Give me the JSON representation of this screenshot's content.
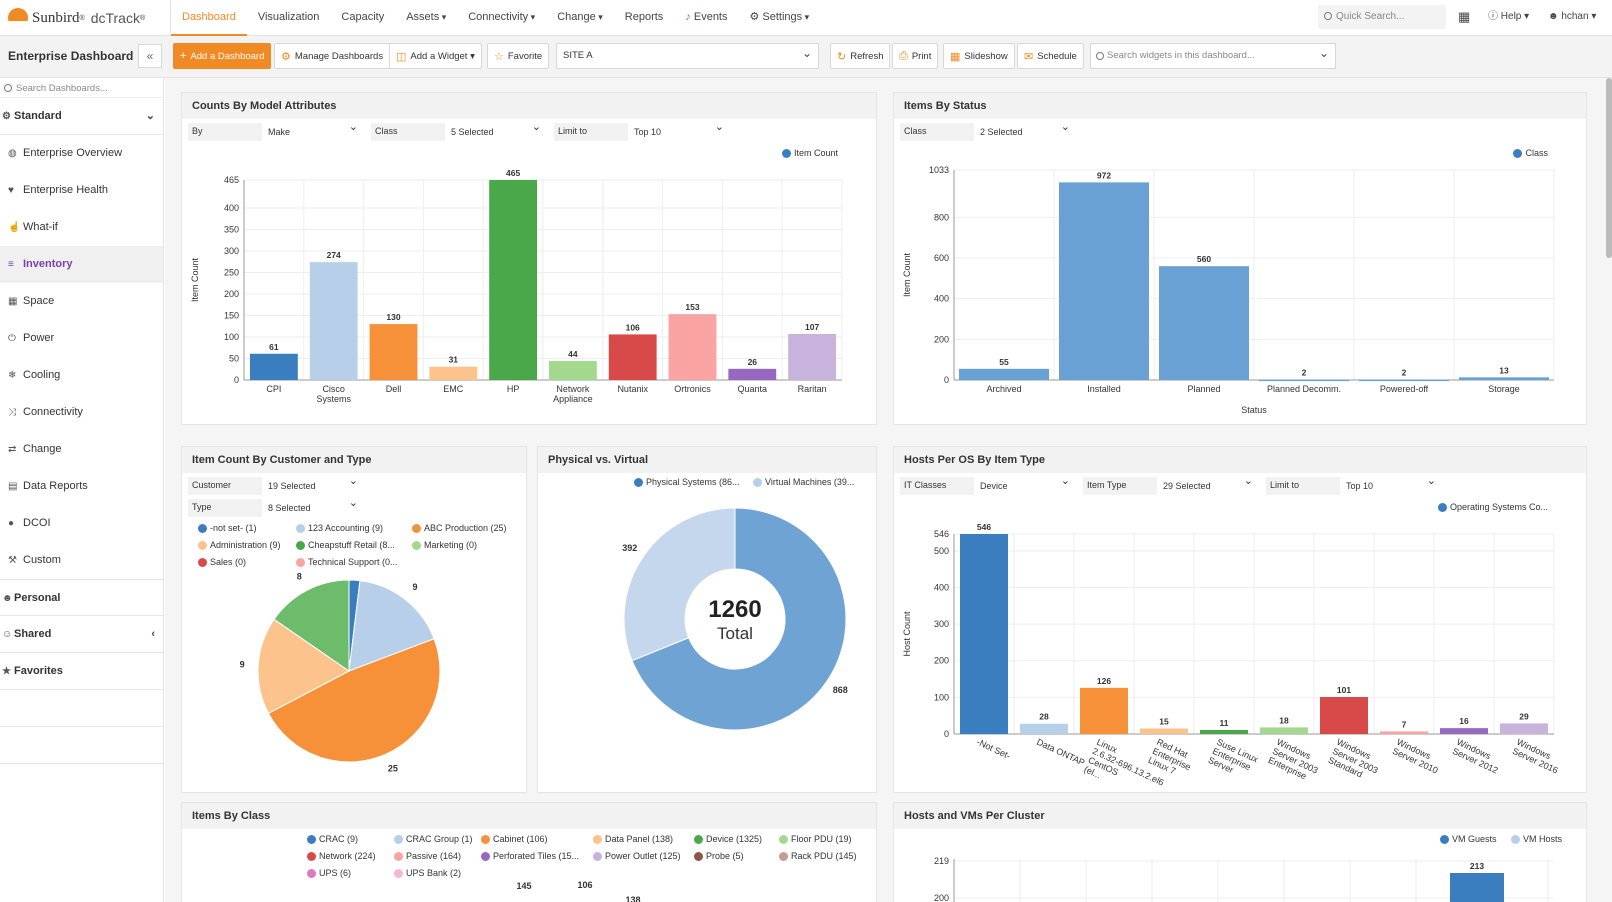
{
  "app": {
    "brand": "Sunbird",
    "product": "dcTrack"
  },
  "nav": [
    {
      "label": "Dashboard",
      "active": true,
      "caret": false
    },
    {
      "label": "Visualization",
      "caret": false
    },
    {
      "label": "Capacity",
      "caret": false
    },
    {
      "label": "Assets",
      "caret": true
    },
    {
      "label": "Connectivity",
      "caret": true
    },
    {
      "label": "Change",
      "caret": true
    },
    {
      "label": "Reports",
      "caret": false
    },
    {
      "label": "Events",
      "caret": false
    },
    {
      "label": "Settings",
      "caret": true
    }
  ],
  "quick_search": {
    "placeholder": "Quick Search..."
  },
  "help_label": "Help",
  "user_label": "hchan",
  "dashboard_title": "Enterprise Dashboard",
  "toolbar": {
    "add_dashboard": "Add a Dashboard",
    "manage_dashboards": "Manage Dashboards",
    "add_widget": "Add a Widget",
    "favorite": "Favorite",
    "site": "SITE A",
    "refresh": "Refresh",
    "print": "Print",
    "slideshow": "Slideshow",
    "schedule": "Schedule",
    "search_widgets_placeholder": "Search widgets in this dashboard..."
  },
  "sidebar": {
    "search_placeholder": "Search Dashboards...",
    "standard": "Standard",
    "items": [
      {
        "label": "Enterprise Overview",
        "icon": "globe-icon",
        "glyph": "◍"
      },
      {
        "label": "Enterprise Health",
        "icon": "heart-icon",
        "glyph": "♥"
      },
      {
        "label": "What-if",
        "icon": "thumbs-up-icon",
        "glyph": "☝"
      },
      {
        "label": "Inventory",
        "icon": "barcode-icon",
        "glyph": "≡",
        "active": true
      },
      {
        "label": "Space",
        "icon": "cubes-icon",
        "glyph": "▦"
      },
      {
        "label": "Power",
        "icon": "power-icon",
        "glyph": "⏻"
      },
      {
        "label": "Cooling",
        "icon": "thermometer-icon",
        "glyph": "❄"
      },
      {
        "label": "Connectivity",
        "icon": "random-icon",
        "glyph": "⤨"
      },
      {
        "label": "Change",
        "icon": "exchange-icon",
        "glyph": "⇄"
      },
      {
        "label": "Data Reports",
        "icon": "table-icon",
        "glyph": "▤"
      },
      {
        "label": "DCOI",
        "icon": "circle-icon",
        "glyph": "●"
      },
      {
        "label": "Custom",
        "icon": "wrench-icon",
        "glyph": "⚒"
      }
    ],
    "personal": "Personal",
    "shared": "Shared",
    "favorites": "Favorites"
  },
  "panels": {
    "counts_model": {
      "title": "Counts By Model Attributes",
      "filters": [
        {
          "label": "By",
          "value": "Make"
        },
        {
          "label": "Class",
          "value": "5 Selected"
        },
        {
          "label": "Limit to",
          "value": "Top 10"
        }
      ]
    },
    "items_status": {
      "title": "Items By Status",
      "filters": [
        {
          "label": "Class",
          "value": "2 Selected"
        }
      ]
    },
    "customer_type": {
      "title": "Item Count By Customer and Type",
      "filters": [
        {
          "label": "Customer",
          "value": "19 Selected"
        },
        {
          "label": "Type",
          "value": "8 Selected"
        }
      ]
    },
    "phys_virtual": {
      "title": "Physical vs. Virtual"
    },
    "hosts_os": {
      "title": "Hosts Per OS By Item Type",
      "filters": [
        {
          "label": "IT Classes",
          "value": "Device"
        },
        {
          "label": "Item Type",
          "value": "29 Selected"
        },
        {
          "label": "Limit to",
          "value": "Top 10"
        }
      ]
    },
    "items_class": {
      "title": "Items By Class"
    },
    "hosts_vms": {
      "title": "Hosts and VMs Per Cluster"
    }
  },
  "chart_data": [
    {
      "type": "bar",
      "title": "Counts By Model Attributes",
      "categories": [
        "CPI",
        "Cisco Systems",
        "Dell",
        "EMC",
        "HP",
        "Network Appliance",
        "Nutanix",
        "Ortronics",
        "Quanta",
        "Raritan"
      ],
      "values": [
        61,
        274,
        130,
        31,
        465,
        44,
        106,
        153,
        26,
        107
      ],
      "colors": [
        "#3a7ebf",
        "#b7cfe9",
        "#f6913a",
        "#fdc38d",
        "#4aa84a",
        "#a3d98e",
        "#d84a4a",
        "#f9a3a2",
        "#9668c2",
        "#c8b3dc"
      ],
      "ylabel": "Item Count",
      "legend": [
        "Item Count"
      ],
      "yticks": [
        0,
        50,
        100,
        150,
        200,
        250,
        300,
        350,
        400,
        465
      ],
      "ylim": [
        0,
        465
      ]
    },
    {
      "type": "bar",
      "title": "Items By Status",
      "categories": [
        "Archived",
        "Installed",
        "Planned",
        "Planned Decomm.",
        "Powered-off",
        "Storage"
      ],
      "values": [
        55,
        972,
        560,
        2,
        2,
        13
      ],
      "xlabel": "Status",
      "ylabel": "Item Count",
      "legend": [
        "Class"
      ],
      "yticks": [
        0,
        200,
        400,
        600,
        800,
        1033
      ],
      "ylim": [
        0,
        1033
      ]
    },
    {
      "type": "pie",
      "title": "Item Count By Customer and Type",
      "legend": [
        {
          "label": "-not set- (1)",
          "color": "#3a7ebf"
        },
        {
          "label": "123 Accounting (9)",
          "color": "#b7cfe9"
        },
        {
          "label": "ABC Production (25)",
          "color": "#f6913a"
        },
        {
          "label": "Administration (9)",
          "color": "#fdc38d"
        },
        {
          "label": "Cheapstuff Retail (8...",
          "color": "#4aa84a"
        },
        {
          "label": "Marketing (0)",
          "color": "#a3d98e"
        },
        {
          "label": "Sales (0)",
          "color": "#d84a4a"
        },
        {
          "label": "Technical Support (0...",
          "color": "#f9a3a2"
        }
      ],
      "slices": [
        {
          "value": 1,
          "color": "#3a7ebf",
          "label": ""
        },
        {
          "value": 9,
          "color": "#b7cfe9",
          "label": "9"
        },
        {
          "value": 25,
          "color": "#f6913a",
          "label": "25"
        },
        {
          "value": 9,
          "color": "#fdc38d",
          "label": "9"
        },
        {
          "value": 8,
          "color": "#6cbc6c",
          "label": "8"
        }
      ]
    },
    {
      "type": "pie",
      "title": "Physical vs. Virtual",
      "legend": [
        {
          "label": "Physical Systems (86...",
          "color": "#3a7ebf"
        },
        {
          "label": "Virtual Machines (39...",
          "color": "#b7cfe9"
        }
      ],
      "slices": [
        {
          "value": 868,
          "color": "#6fa3d3",
          "label": "868"
        },
        {
          "value": 392,
          "color": "#c4d7ed",
          "label": "392"
        }
      ],
      "total": "1260",
      "total_label": "Total"
    },
    {
      "type": "bar",
      "title": "Hosts Per OS By Item Type",
      "categories": [
        "-Not Set-",
        "Data ONTAP",
        "Linux 2.6.32-696.13.2.el6 CentOS",
        "Red Hat Enterprise Linux 7",
        "Suse Linux Enterprise Server",
        "Windows Server 2003 Enterprise",
        "Windows Server 2003 Standard",
        "Windows Server 2010",
        "Windows Server 2012",
        "Windows Server 2016"
      ],
      "category_lines": [
        [
          "-Not Set-"
        ],
        [
          "Data ONTAP"
        ],
        [
          "Linux",
          "2.6.32-696.13.2.el6",
          "CentOS",
          "(el..."
        ],
        [
          "Red Hat",
          "Enterprise",
          "Linux 7"
        ],
        [
          "Suse Linux",
          "Enterprise",
          "Server"
        ],
        [
          "Windows",
          "Server 2003",
          "Enterprise"
        ],
        [
          "Windows",
          "Server 2003",
          "Standard"
        ],
        [
          "Windows",
          "Server 2010"
        ],
        [
          "Windows",
          "Server 2012"
        ],
        [
          "Windows",
          "Server 2016"
        ]
      ],
      "values": [
        546,
        28,
        126,
        15,
        11,
        18,
        101,
        7,
        16,
        29
      ],
      "colors": [
        "#3a7ebf",
        "#b7cfe9",
        "#f6913a",
        "#fdc38d",
        "#4aa84a",
        "#a3d98e",
        "#d84a4a",
        "#f9a3a2",
        "#9668c2",
        "#c8b3dc"
      ],
      "ylabel": "Host Count",
      "legend": [
        "Operating Systems Co..."
      ],
      "yticks": [
        0,
        100,
        200,
        300,
        400,
        500,
        546
      ],
      "ylim": [
        0,
        546
      ]
    },
    {
      "type": "pie",
      "title": "Items By Class",
      "legend": [
        {
          "label": "CRAC (9)",
          "color": "#3a7ebf"
        },
        {
          "label": "CRAC Group (1)",
          "color": "#b7cfe9"
        },
        {
          "label": "Cabinet (106)",
          "color": "#f6913a"
        },
        {
          "label": "Data Panel (138)",
          "color": "#fdc38d"
        },
        {
          "label": "Device (1325)",
          "color": "#4aa84a"
        },
        {
          "label": "Floor PDU (19)",
          "color": "#a3d98e"
        },
        {
          "label": "Network (224)",
          "color": "#d84a4a"
        },
        {
          "label": "Passive (164)",
          "color": "#f9a3a2"
        },
        {
          "label": "Perforated Tiles (15...",
          "color": "#9668c2"
        },
        {
          "label": "Power Outlet (125)",
          "color": "#c8b3dc"
        },
        {
          "label": "Probe (5)",
          "color": "#8c564b"
        },
        {
          "label": "Rack PDU (145)",
          "color": "#c49c94"
        },
        {
          "label": "UPS (6)",
          "color": "#e377c2"
        },
        {
          "label": "UPS Bank (2)",
          "color": "#f7b6d2"
        }
      ],
      "visible_labels": [
        "145",
        "106",
        "138"
      ]
    },
    {
      "type": "bar",
      "title": "Hosts and VMs Per Cluster",
      "legend": [
        {
          "label": "VM Guests",
          "color": "#3a7ebf"
        },
        {
          "label": "VM Hosts",
          "color": "#b7cfe9"
        }
      ],
      "yticks": [
        "219",
        "200"
      ],
      "visible_values": [
        213
      ]
    }
  ]
}
